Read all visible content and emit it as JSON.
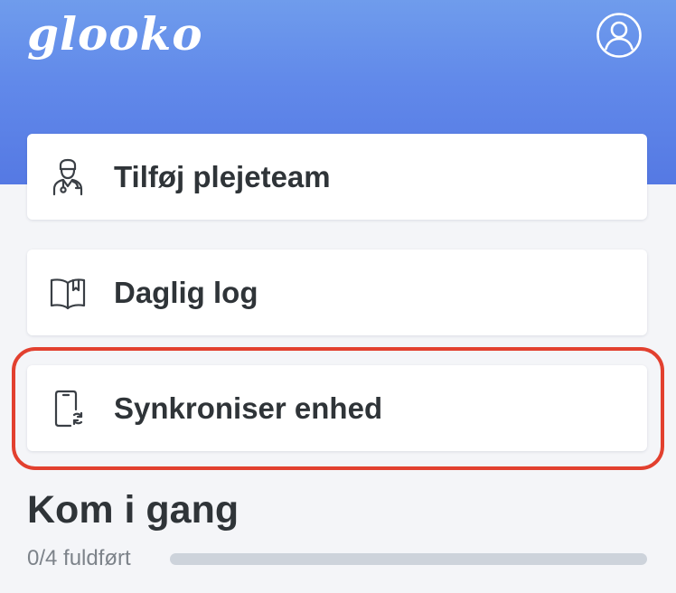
{
  "header": {
    "logo_text": "glooko",
    "profile_icon": "profile-icon"
  },
  "cards": [
    {
      "label": "Tilføj plejeteam",
      "icon": "care-team-icon"
    },
    {
      "label": "Daglig log",
      "icon": "book-icon"
    },
    {
      "label": "Synkroniser enhed",
      "icon": "sync-device-icon",
      "highlighted": true
    }
  ],
  "get_started": {
    "title": "Kom i gang",
    "progress_text": "0/4 fuldført",
    "completed": 0,
    "total": 4
  },
  "colors": {
    "header_gradient_top": "#6f9cec",
    "header_gradient_bottom": "#5579e3",
    "highlight": "#e2402f",
    "text": "#2f3438"
  }
}
